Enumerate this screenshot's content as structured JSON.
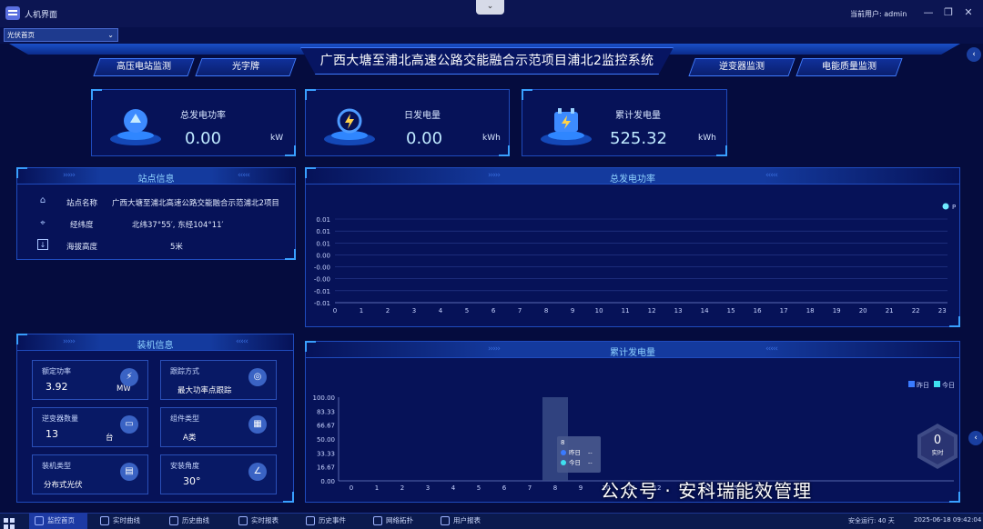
{
  "window": {
    "title": "人机界面",
    "dropdown_caret": "⌄",
    "user_label": "当前用户:  admin",
    "minimize": "—",
    "restore": "❐",
    "close": "✕"
  },
  "page_select": {
    "value": "光伏首页"
  },
  "header": {
    "title": "广西大塘至浦北高速公路交能融合示范项目浦北2监控系统"
  },
  "nav_tabs": [
    "高压电站监测",
    "光字牌",
    "逆变器监测",
    "电能质量监测"
  ],
  "kpis": [
    {
      "label": "总发电功率",
      "value": "0.00",
      "unit": "kW",
      "icon": "power-gauge-icon"
    },
    {
      "label": "日发电量",
      "value": "0.00",
      "unit": "kWh",
      "icon": "lightning-clock-icon"
    },
    {
      "label": "累计发电量",
      "value": "525.32",
      "unit": "kWh",
      "icon": "battery-calendar-icon"
    }
  ],
  "station": {
    "title": "站点信息",
    "rows": [
      {
        "label": "站点名称",
        "value": "广西大塘至浦北高速公路交能融合示范浦北2项目",
        "icon": "home-icon"
      },
      {
        "label": "经纬度",
        "value": "北纬37°55′, 东经104°11′",
        "icon": "location-icon"
      },
      {
        "label": "海拔高度",
        "value": "5米",
        "icon": "altitude-icon"
      }
    ]
  },
  "install": {
    "title": "装机信息",
    "cards": [
      {
        "label": "额定功率",
        "value": "3.92",
        "unit": "MW",
        "icon": "power-icon"
      },
      {
        "label": "跟踪方式",
        "value": "最大功率点跟踪",
        "unit": "",
        "icon": "target-icon"
      },
      {
        "label": "逆变器数量",
        "value": "13",
        "unit": "台",
        "icon": "inverter-icon"
      },
      {
        "label": "组件类型",
        "value": "A类",
        "unit": "",
        "icon": "grid-icon"
      },
      {
        "label": "装机类型",
        "value": "分布式光伏",
        "unit": "",
        "icon": "layout-icon"
      },
      {
        "label": "安装角度",
        "value": "30°",
        "unit": "",
        "icon": "angle-icon"
      }
    ]
  },
  "arrows": {
    "left": "›››››",
    "right": "‹‹‹‹‹"
  },
  "chart_data": [
    {
      "type": "line",
      "title": "总发电功率",
      "x": [
        0,
        1,
        2,
        3,
        4,
        5,
        6,
        7,
        8,
        9,
        10,
        11,
        12,
        13,
        14,
        15,
        16,
        17,
        18,
        19,
        20,
        21,
        22,
        23
      ],
      "series": [
        {
          "name": "P",
          "values": []
        }
      ],
      "yticks": [
        "0.01",
        "0.01",
        "0.01",
        "0.00",
        "-0.00",
        "-0.00",
        "-0.01",
        "-0.01"
      ],
      "legend": "top-right",
      "color": "#6ee8ff"
    },
    {
      "type": "bar",
      "title": "累计发电量",
      "x": [
        0,
        1,
        2,
        3,
        4,
        5,
        6,
        7,
        8,
        9,
        10,
        11,
        12,
        13,
        14,
        15,
        16
      ],
      "series": [
        {
          "name": "昨日",
          "values": []
        },
        {
          "name": "今日",
          "values": []
        }
      ],
      "ylim": [
        0,
        100
      ],
      "yticks": [
        "100.00",
        "83.33",
        "66.67",
        "50.00",
        "33.33",
        "16.67",
        "0.00"
      ],
      "highlight_x": 8,
      "tooltip": {
        "title": "8",
        "rows": [
          {
            "name": "昨日",
            "value": "--"
          },
          {
            "name": "今日",
            "value": "--"
          }
        ]
      },
      "legend": "top-right",
      "colors": {
        "昨日": "#3a7bff",
        "今日": "#3fe0f0"
      }
    }
  ],
  "realtime_badge": {
    "value": "0",
    "label": "实时"
  },
  "watermark": "公众号 · 安科瑞能效管理",
  "taskbar": {
    "items": [
      "监控首页",
      "实时曲线",
      "历史曲线",
      "实时报表",
      "历史事件",
      "网络拓扑",
      "用户报表"
    ],
    "status": "安全运行: 40 天",
    "datetime": "2025-06-18 09:42:04"
  }
}
